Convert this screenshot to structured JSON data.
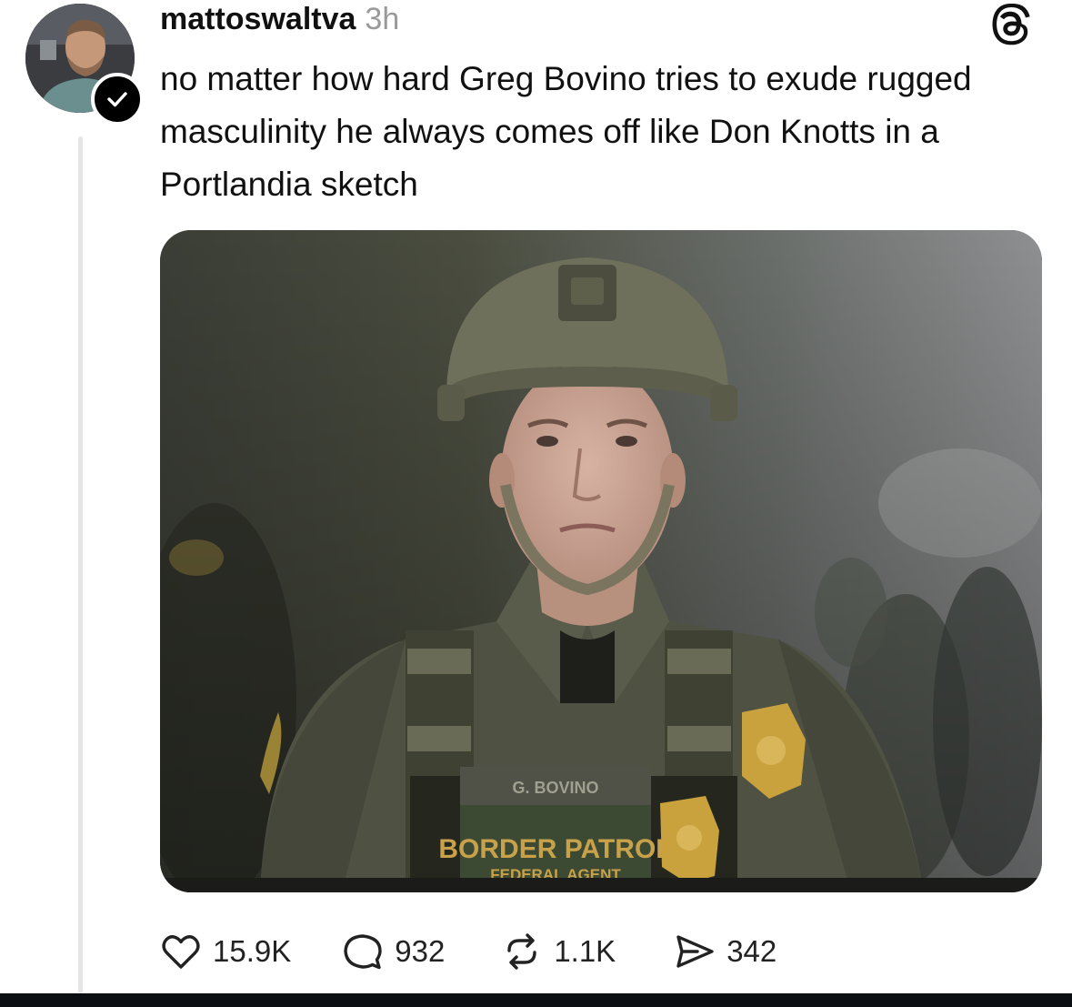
{
  "post": {
    "username": "mattoswaltva",
    "time": "3h",
    "text": "no matter how hard Greg Bovino tries to exude rugged masculinity he always comes off like Don Knotts in a Portlandia sketch",
    "verified": true
  },
  "media": {
    "name_tape": "G. BOVINO",
    "patch_line1": "BORDER PATROL",
    "patch_line2": "FEDERAL AGENT"
  },
  "actions": {
    "likes": "15.9K",
    "replies": "932",
    "reposts": "1.1K",
    "shares": "342"
  },
  "icons": {
    "app": "threads-icon",
    "verified": "checkmark-icon",
    "like": "heart-icon",
    "reply": "comment-icon",
    "repost": "repost-icon",
    "share": "send-icon"
  },
  "colors": {
    "text": "#111111",
    "muted": "#9a9a9a",
    "thread_line": "#e6e6e6"
  }
}
